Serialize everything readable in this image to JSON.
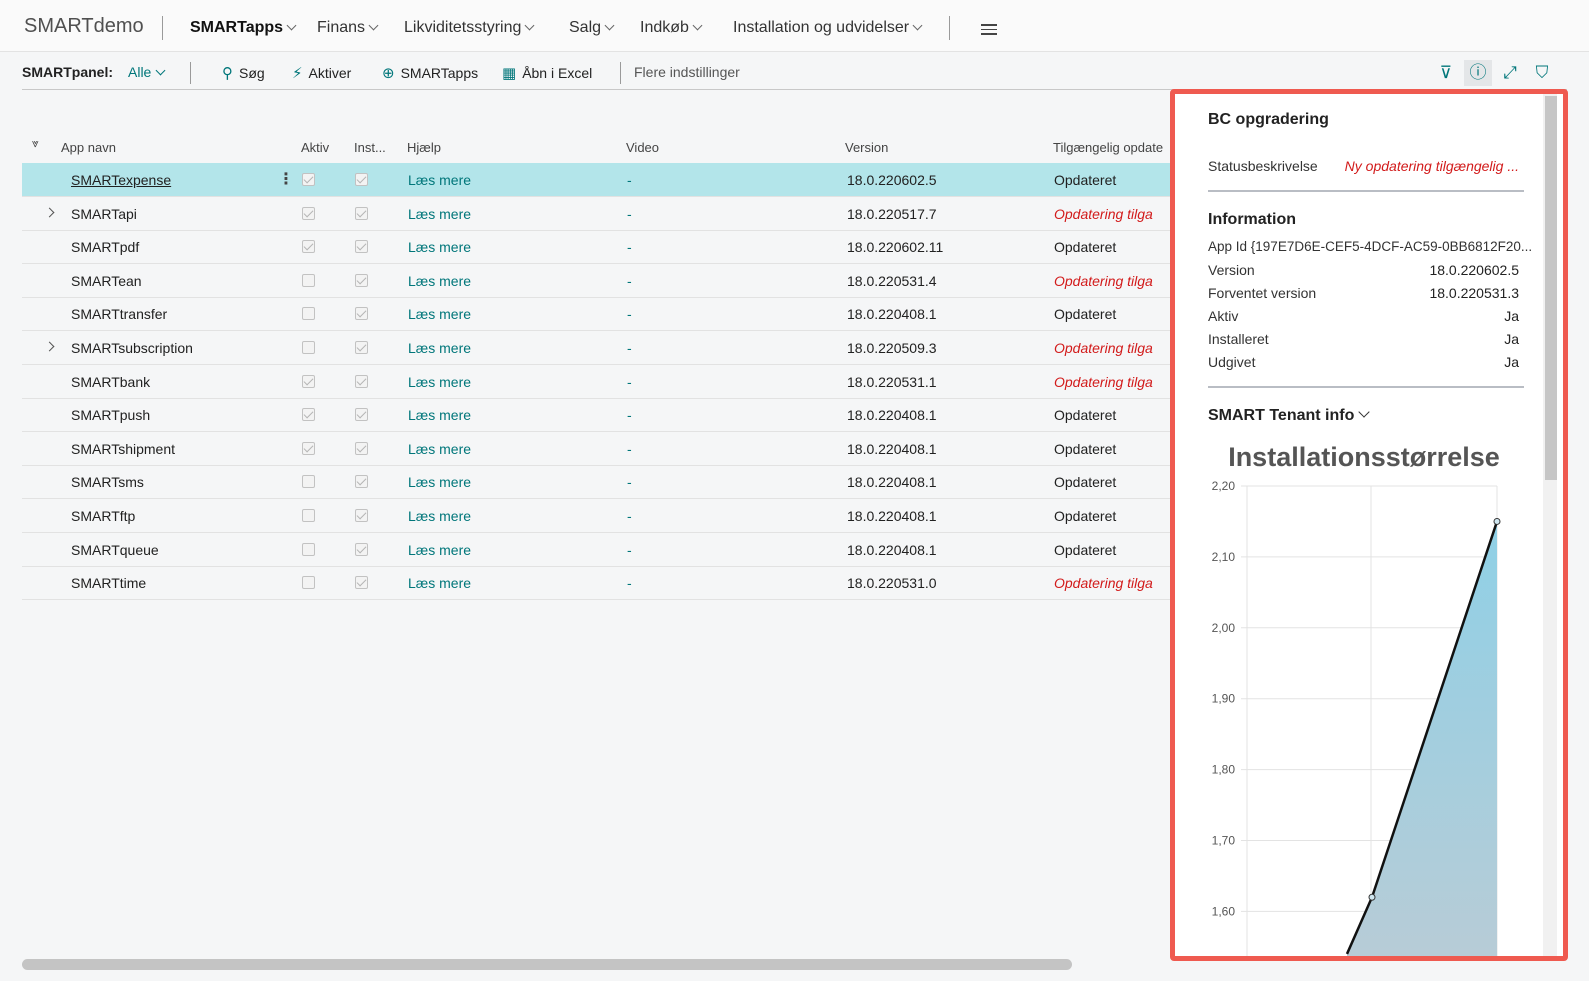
{
  "app": {
    "title": "SMARTdemo"
  },
  "nav": {
    "items": [
      {
        "label": "SMARTapps"
      },
      {
        "label": "Finans"
      },
      {
        "label": "Likviditetsstyring"
      },
      {
        "label": "Salg"
      },
      {
        "label": "Indkøb"
      },
      {
        "label": "Installation og udvidelser"
      }
    ]
  },
  "actionbar": {
    "panel_label": "SMARTpanel:",
    "panel_value": "Alle",
    "search": "Søg",
    "activate": "Aktiver",
    "smartapps": "SMARTapps",
    "excel": "Åbn i Excel",
    "more": "Flere indstillinger",
    "icons": [
      "filter-icon",
      "info-icon",
      "expand-icon",
      "bookmark-icon"
    ]
  },
  "grid": {
    "headers": {
      "name": "App navn",
      "active": "Aktiv",
      "installed": "Inst...",
      "help": "Hjælp",
      "video": "Video",
      "version": "Version",
      "available": "Tilgængelig opdate"
    },
    "rows": [
      {
        "name": "SMARTexpense",
        "active": true,
        "installed": true,
        "help": "Læs mere",
        "video": "-",
        "version": "18.0.220602.5",
        "status": "Opdateret",
        "update": false,
        "expand": false,
        "selected": true
      },
      {
        "name": "SMARTapi",
        "active": true,
        "installed": true,
        "help": "Læs mere",
        "video": "-",
        "version": "18.0.220517.7",
        "status": "Opdatering tilga",
        "update": true,
        "expand": true,
        "selected": false
      },
      {
        "name": "SMARTpdf",
        "active": true,
        "installed": true,
        "help": "Læs mere",
        "video": "-",
        "version": "18.0.220602.11",
        "status": "Opdateret",
        "update": false,
        "expand": false,
        "selected": false
      },
      {
        "name": "SMARTean",
        "active": false,
        "installed": true,
        "help": "Læs mere",
        "video": "-",
        "version": "18.0.220531.4",
        "status": "Opdatering tilga",
        "update": true,
        "expand": false,
        "selected": false
      },
      {
        "name": "SMARTtransfer",
        "active": false,
        "installed": true,
        "help": "Læs mere",
        "video": "-",
        "version": "18.0.220408.1",
        "status": "Opdateret",
        "update": false,
        "expand": false,
        "selected": false
      },
      {
        "name": "SMARTsubscription",
        "active": false,
        "installed": true,
        "help": "Læs mere",
        "video": "-",
        "version": "18.0.220509.3",
        "status": "Opdatering tilga",
        "update": true,
        "expand": true,
        "selected": false
      },
      {
        "name": "SMARTbank",
        "active": true,
        "installed": true,
        "help": "Læs mere",
        "video": "-",
        "version": "18.0.220531.1",
        "status": "Opdatering tilga",
        "update": true,
        "expand": false,
        "selected": false
      },
      {
        "name": "SMARTpush",
        "active": true,
        "installed": true,
        "help": "Læs mere",
        "video": "-",
        "version": "18.0.220408.1",
        "status": "Opdateret",
        "update": false,
        "expand": false,
        "selected": false
      },
      {
        "name": "SMARTshipment",
        "active": true,
        "installed": true,
        "help": "Læs mere",
        "video": "-",
        "version": "18.0.220408.1",
        "status": "Opdateret",
        "update": false,
        "expand": false,
        "selected": false
      },
      {
        "name": "SMARTsms",
        "active": false,
        "installed": true,
        "help": "Læs mere",
        "video": "-",
        "version": "18.0.220408.1",
        "status": "Opdateret",
        "update": false,
        "expand": false,
        "selected": false
      },
      {
        "name": "SMARTftp",
        "active": false,
        "installed": true,
        "help": "Læs mere",
        "video": "-",
        "version": "18.0.220408.1",
        "status": "Opdateret",
        "update": false,
        "expand": false,
        "selected": false
      },
      {
        "name": "SMARTqueue",
        "active": false,
        "installed": true,
        "help": "Læs mere",
        "video": "-",
        "version": "18.0.220408.1",
        "status": "Opdateret",
        "update": false,
        "expand": false,
        "selected": false
      },
      {
        "name": "SMARTtime",
        "active": false,
        "installed": true,
        "help": "Læs mere",
        "video": "-",
        "version": "18.0.220531.0",
        "status": "Opdatering tilga",
        "update": true,
        "expand": false,
        "selected": false
      }
    ]
  },
  "factbox": {
    "bc_title": "BC opgradering",
    "status_label": "Statusbeskrivelse",
    "status_value": "Ny opdatering tilgængelig ...",
    "info_title": "Information",
    "app_id": "App Id {197E7D6E-CEF5-4DCF-AC59-0BB6812F20...",
    "fields": [
      {
        "label": "Version",
        "value": "18.0.220602.5"
      },
      {
        "label": "Forventet version",
        "value": "18.0.220531.3"
      },
      {
        "label": "Aktiv",
        "value": "Ja"
      },
      {
        "label": "Installeret",
        "value": "Ja"
      },
      {
        "label": "Udgivet",
        "value": "Ja"
      }
    ],
    "tenant_title": "SMART Tenant info"
  },
  "colors": {
    "accent": "#00767a",
    "selected_row": "#b3e5ea",
    "update_red": "#d21a1a",
    "highlight_border": "#ef5a50"
  },
  "chart_data": {
    "type": "area",
    "title": "Installationsstørrelse",
    "x": [
      1,
      2,
      3
    ],
    "values": [
      1.54,
      1.62,
      2.15
    ],
    "yticks": [
      "1,60",
      "1,70",
      "1,80",
      "1,90",
      "2,00",
      "2,10",
      "2,20"
    ],
    "ylim": [
      1.58,
      2.2
    ],
    "grid": true
  }
}
